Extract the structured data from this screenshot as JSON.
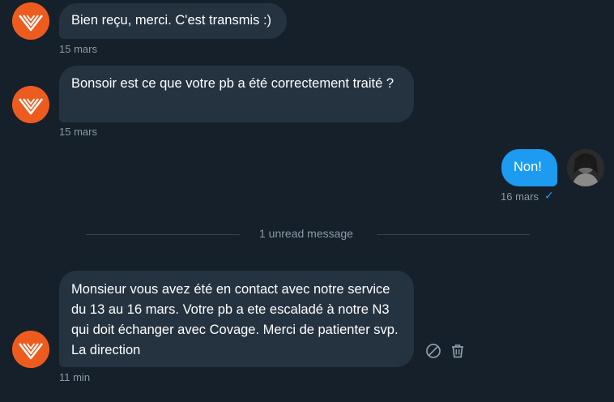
{
  "messages": [
    {
      "text": "Bien reçu, merci. C'est transmis :)",
      "timestamp": "15 mars"
    },
    {
      "text": "Bonsoir est ce que votre pb a été correctement traité ?",
      "timestamp": "15 mars"
    },
    {
      "text": "Non!",
      "timestamp": "16 mars",
      "read_indicator": "✓"
    },
    {
      "text": "Monsieur vous avez été en contact avec notre service du 13 au 16 mars. Votre pb a ete escaladé à notre N3 qui doit échanger avec Covage. Merci de patienter svp. La direction",
      "timestamp": "11 min"
    }
  ],
  "unread_divider": "1 unread message",
  "colors": {
    "background": "#15202b",
    "incoming_bubble": "#253341",
    "outgoing_bubble": "#1d9bf0",
    "brand_avatar": "#ee5b1f",
    "muted_text": "#8b98a5"
  },
  "icons": [
    "brand-logo-icon",
    "read-check-icon",
    "block-icon",
    "trash-icon"
  ]
}
